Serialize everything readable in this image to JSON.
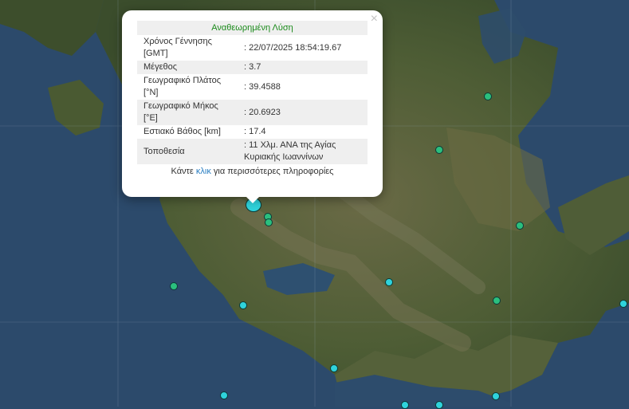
{
  "popup": {
    "header": "Αναθεωρημένη Λύση",
    "close_symbol": "×",
    "rows": [
      {
        "label": "Χρόνος Γέννησης [GMT]",
        "value": ": 22/07/2025 18:54:19.67"
      },
      {
        "label": "Μέγεθος",
        "value": ": 3.7"
      },
      {
        "label": "Γεωγραφικό Πλάτος [°N]",
        "value": ": 39.4588"
      },
      {
        "label": "Γεωγραφικό Μήκος [°E]",
        "value": ": 20.6923"
      },
      {
        "label": "Εστιακό Βάθος [km]",
        "value": ": 17.4"
      },
      {
        "label": "Τοποθεσία",
        "value": ": 11 Χλμ. ΑΝΑ της Αγίας Κυριακής Ιωαννίνων"
      }
    ],
    "footer_prefix": "Κάντε ",
    "footer_link": "κλικ",
    "footer_suffix": " για περισσότερες πληροφορίες"
  },
  "colors": {
    "recent_marker": "#2fd3dc",
    "older_marker": "#2bbf7e",
    "sea": "#2c4a6b",
    "land": "#4b5e33",
    "header_text": "#1a8a1a",
    "link": "#2a7ec2"
  },
  "legend_icons": [
    "earthquake-marker",
    "selected-earthquake-marker",
    "close-icon"
  ]
}
